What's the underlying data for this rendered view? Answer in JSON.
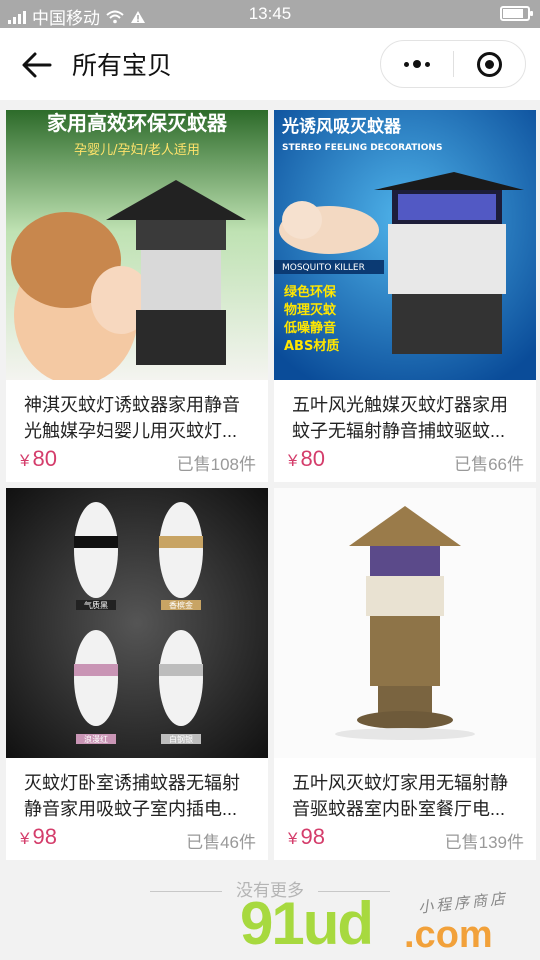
{
  "status_bar": {
    "carrier": "中国移动",
    "time": "13:45",
    "battery_level": 0.85
  },
  "nav": {
    "title": "所有宝贝",
    "back_icon": "arrow-left-icon",
    "more_icon": "more-dots-icon",
    "close_icon": "target-circle-icon"
  },
  "products": [
    {
      "image_text": "家用高效环保灭蚊器",
      "image_subtext": "孕婴儿/孕妇/老人适用",
      "name": "神淇灭蚊灯诱蚊器家用静音光触媒孕妇婴儿用灭蚊灯...",
      "currency": "¥",
      "price": "80",
      "sold": "已售108件"
    },
    {
      "image_text": "光诱风吸灭蚊器",
      "image_subtext": "STEREO FEELING DECORATIONS",
      "image_features": [
        "绿色环保",
        "物理灭蚊",
        "低噪静音",
        "ABS材质"
      ],
      "image_brand": "MOSQUITO KILLER",
      "name": "五叶风光触媒灭蚊灯器家用蚊子无辐射静音捕蚊驱蚊...",
      "currency": "¥",
      "price": "80",
      "sold": "已售66件"
    },
    {
      "image_labels": [
        "气质黑",
        "香槟金",
        "浪漫红",
        "白钢银"
      ],
      "name": "灭蚊灯卧室诱捕蚊器无辐射静音家用吸蚊子室内插电...",
      "currency": "¥",
      "price": "98",
      "sold": "已售46件"
    },
    {
      "name": "五叶风灭蚊灯家用无辐射静音驱蚊器室内卧室餐厅电...",
      "currency": "¥",
      "price": "98",
      "sold": "已售139件"
    }
  ],
  "footer": {
    "no_more": "没有更多"
  },
  "watermark": {
    "main": "91ud",
    "suffix": ".com",
    "tagline": "小程序商店"
  },
  "colors": {
    "price": "#d43d6b",
    "status_bar": "#a9a9a9",
    "watermark_green": "#a7d93f",
    "watermark_orange": "#f2a13a"
  }
}
